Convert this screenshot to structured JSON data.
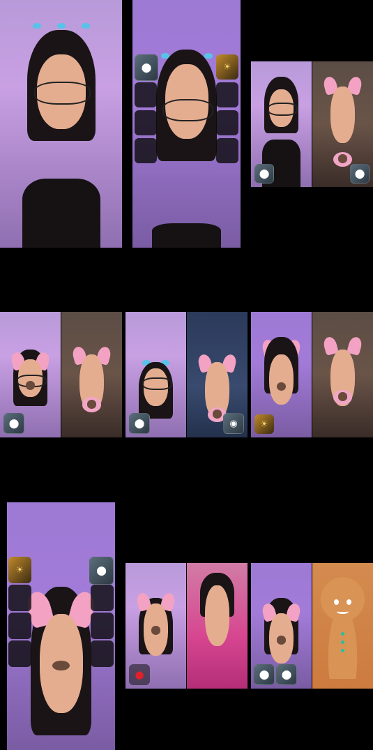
{
  "layout": "live-stream-grid",
  "icons": {
    "person": "person-avatar-icon",
    "sun": "sun-sticker-icon",
    "record": "record-dot-icon",
    "cat": "cat-avatar-icon"
  },
  "glyphs": {
    "person": "⬤",
    "sun": "☀",
    "record": "●",
    "cat": "◉"
  },
  "colors": {
    "background": "#000000",
    "ears": "#f3a2c3",
    "accent": "#59c2e8"
  }
}
